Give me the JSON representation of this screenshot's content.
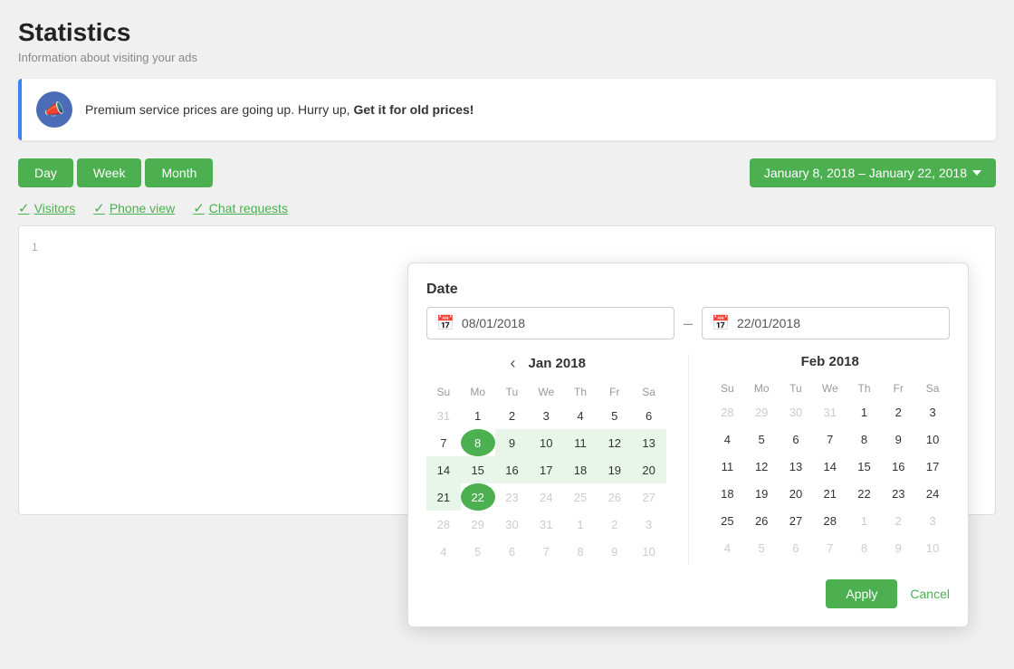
{
  "page": {
    "title": "Statistics",
    "subtitle": "Information about visiting your ads"
  },
  "notification": {
    "text": "Premium service prices are going up. Hurry up,",
    "bold_text": "Get it for old prices!",
    "icon": "📣"
  },
  "controls": {
    "day_label": "Day",
    "week_label": "Week",
    "month_label": "Month",
    "date_range_label": "January 8, 2018 – January 22, 2018"
  },
  "checkboxes": [
    {
      "label": "Visitors",
      "checked": true
    },
    {
      "label": "Phone view",
      "checked": true
    },
    {
      "label": "Chat requests",
      "checked": true
    }
  ],
  "chart": {
    "y_value": "1"
  },
  "date_picker": {
    "label": "Date",
    "start_value": "08/01/2018",
    "end_value": "22/01/2018",
    "left_calendar": {
      "month_label": "Jan 2018",
      "days_of_week": [
        "Su",
        "Mo",
        "Tu",
        "We",
        "Th",
        "Fr",
        "Sa"
      ],
      "weeks": [
        [
          {
            "d": "31",
            "state": "inactive"
          },
          {
            "d": "1",
            "state": "active"
          },
          {
            "d": "2",
            "state": "active"
          },
          {
            "d": "3",
            "state": "active"
          },
          {
            "d": "4",
            "state": "active"
          },
          {
            "d": "5",
            "state": "active"
          },
          {
            "d": "6",
            "state": "active"
          }
        ],
        [
          {
            "d": "7",
            "state": "active"
          },
          {
            "d": "8",
            "state": "selected-start"
          },
          {
            "d": "9",
            "state": "in-range"
          },
          {
            "d": "10",
            "state": "in-range"
          },
          {
            "d": "11",
            "state": "in-range"
          },
          {
            "d": "12",
            "state": "in-range"
          },
          {
            "d": "13",
            "state": "in-range"
          }
        ],
        [
          {
            "d": "14",
            "state": "in-range"
          },
          {
            "d": "15",
            "state": "in-range"
          },
          {
            "d": "16",
            "state": "in-range"
          },
          {
            "d": "17",
            "state": "in-range"
          },
          {
            "d": "18",
            "state": "in-range"
          },
          {
            "d": "19",
            "state": "in-range"
          },
          {
            "d": "20",
            "state": "in-range"
          }
        ],
        [
          {
            "d": "21",
            "state": "in-range"
          },
          {
            "d": "22",
            "state": "selected-end"
          },
          {
            "d": "23",
            "state": "inactive"
          },
          {
            "d": "24",
            "state": "inactive"
          },
          {
            "d": "25",
            "state": "inactive"
          },
          {
            "d": "26",
            "state": "inactive"
          },
          {
            "d": "27",
            "state": "inactive"
          }
        ],
        [
          {
            "d": "28",
            "state": "inactive"
          },
          {
            "d": "29",
            "state": "inactive"
          },
          {
            "d": "30",
            "state": "inactive"
          },
          {
            "d": "31",
            "state": "inactive"
          },
          {
            "d": "1",
            "state": "inactive"
          },
          {
            "d": "2",
            "state": "inactive"
          },
          {
            "d": "3",
            "state": "inactive"
          }
        ],
        [
          {
            "d": "4",
            "state": "inactive"
          },
          {
            "d": "5",
            "state": "inactive"
          },
          {
            "d": "6",
            "state": "inactive"
          },
          {
            "d": "7",
            "state": "inactive"
          },
          {
            "d": "8",
            "state": "inactive"
          },
          {
            "d": "9",
            "state": "inactive"
          },
          {
            "d": "10",
            "state": "inactive"
          }
        ]
      ]
    },
    "right_calendar": {
      "month_label": "Feb 2018",
      "days_of_week": [
        "Su",
        "Mo",
        "Tu",
        "We",
        "Th",
        "Fr",
        "Sa"
      ],
      "weeks": [
        [
          {
            "d": "28",
            "state": "inactive"
          },
          {
            "d": "29",
            "state": "inactive"
          },
          {
            "d": "30",
            "state": "inactive"
          },
          {
            "d": "31",
            "state": "inactive"
          },
          {
            "d": "1",
            "state": "active"
          },
          {
            "d": "2",
            "state": "active"
          },
          {
            "d": "3",
            "state": "active"
          }
        ],
        [
          {
            "d": "4",
            "state": "active"
          },
          {
            "d": "5",
            "state": "active"
          },
          {
            "d": "6",
            "state": "active"
          },
          {
            "d": "7",
            "state": "active"
          },
          {
            "d": "8",
            "state": "active"
          },
          {
            "d": "9",
            "state": "active"
          },
          {
            "d": "10",
            "state": "active"
          }
        ],
        [
          {
            "d": "11",
            "state": "active"
          },
          {
            "d": "12",
            "state": "active"
          },
          {
            "d": "13",
            "state": "active"
          },
          {
            "d": "14",
            "state": "active"
          },
          {
            "d": "15",
            "state": "active"
          },
          {
            "d": "16",
            "state": "active"
          },
          {
            "d": "17",
            "state": "active"
          }
        ],
        [
          {
            "d": "18",
            "state": "active"
          },
          {
            "d": "19",
            "state": "active"
          },
          {
            "d": "20",
            "state": "active"
          },
          {
            "d": "21",
            "state": "active"
          },
          {
            "d": "22",
            "state": "active"
          },
          {
            "d": "23",
            "state": "active"
          },
          {
            "d": "24",
            "state": "active"
          }
        ],
        [
          {
            "d": "25",
            "state": "active"
          },
          {
            "d": "26",
            "state": "active"
          },
          {
            "d": "27",
            "state": "active"
          },
          {
            "d": "28",
            "state": "active"
          },
          {
            "d": "1",
            "state": "inactive"
          },
          {
            "d": "2",
            "state": "inactive"
          },
          {
            "d": "3",
            "state": "inactive"
          }
        ],
        [
          {
            "d": "4",
            "state": "inactive"
          },
          {
            "d": "5",
            "state": "inactive"
          },
          {
            "d": "6",
            "state": "inactive"
          },
          {
            "d": "7",
            "state": "inactive"
          },
          {
            "d": "8",
            "state": "inactive"
          },
          {
            "d": "9",
            "state": "inactive"
          },
          {
            "d": "10",
            "state": "inactive"
          }
        ]
      ]
    },
    "apply_label": "Apply",
    "cancel_label": "Cancel"
  }
}
